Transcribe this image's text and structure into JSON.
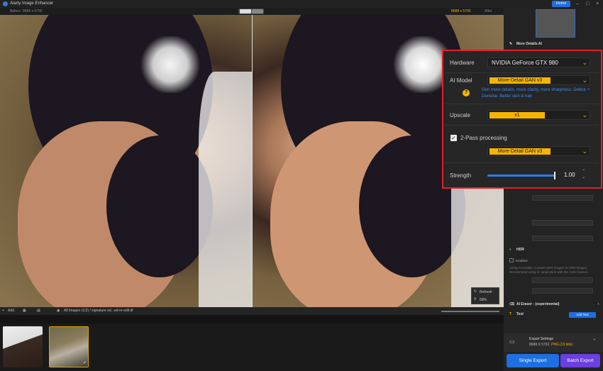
{
  "app": {
    "title": "Aiarty Image Enhancer",
    "home_label": "Home"
  },
  "compare": {
    "before_label": "Before",
    "before_size": "8688 x 5792",
    "after_size": "8688 x 5792",
    "after_label": "After"
  },
  "zoom_box": {
    "refresh_label": "Refresh",
    "zoom_value": "59%"
  },
  "bottom_bar": {
    "add_label": "Add",
    "breadcrumb": "All Images (1/2) / signature ed...ed-re-edit.tif"
  },
  "settings_popup": {
    "hardware_label": "Hardware",
    "hardware_value": "NVIDIA GeForce GTX 980",
    "ai_model_label": "AI Model",
    "ai_model_value": "More-Detail GAN  v3",
    "ai_model_help_icon": "question-icon",
    "ai_model_description": "Gen more details, more clarity, more sharpness. Deblur + Denoise. Better skin & hair.",
    "upscale_label": "Upscale",
    "upscale_value": "x1",
    "two_pass_label": "2-Pass processing",
    "two_pass_checked": true,
    "two_pass_model_value": "More-Detail GAN  v3",
    "strength_label": "Strength",
    "strength_value": "1.00",
    "strength_fraction": 1.0,
    "accent_color": "#f5b400",
    "highlight_border_color": "#e0202a"
  },
  "sidebar": {
    "section_more_details": "More Details AI",
    "section_hdr": "HDR",
    "hdr_enabled_label": "Enabled",
    "hdr_description": "Using AI models. Convert SDR images to HDR images. Recommend using in conjunction with the Color feature.",
    "ai_eraser_label": "AI Eraser - (experimental)",
    "text_label": "Text",
    "add_text_label": "Add Text"
  },
  "export": {
    "settings_label": "Export Settings",
    "size": "8688 X 5792",
    "format": "PNG",
    "bit_depth": "(16 bits)",
    "single_label": "Single Export",
    "batch_label": "Batch Export"
  }
}
